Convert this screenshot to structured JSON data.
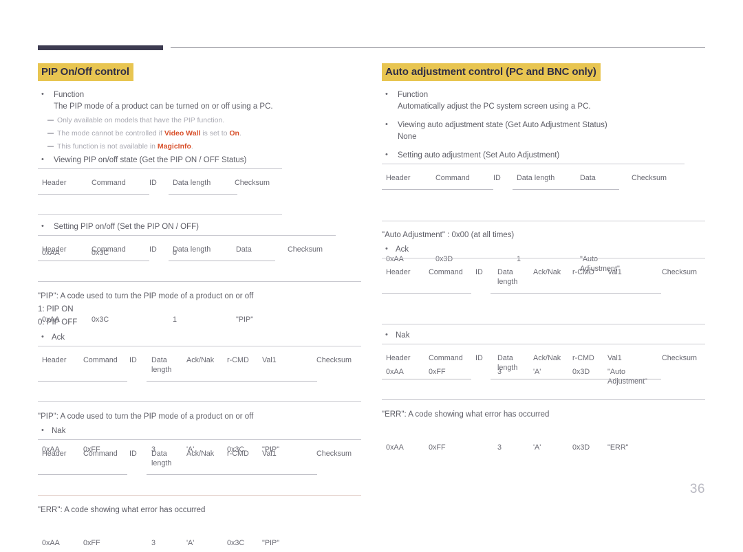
{
  "page": {
    "number": "36"
  },
  "left": {
    "title": "PIP On/Off control",
    "function_label": "Function",
    "function_desc": "The PIP mode of a product can be turned on or off using a PC.",
    "notes": [
      {
        "pre": "Only available on models that have the PIP function.",
        "bold1": "",
        "mid": "",
        "bold2": "",
        "post": ""
      },
      {
        "pre": "The mode cannot be controlled if ",
        "bold1": "Video Wall",
        "mid": " is set to ",
        "bold2": "On",
        "post": "."
      },
      {
        "pre": "This function is not available in ",
        "bold1": "MagicInfo",
        "mid": "",
        "bold2": "",
        "post": "."
      }
    ],
    "get_label": "Viewing PIP on/off state (Get the PIP ON / OFF Status)",
    "get_table": {
      "headers": [
        "Header",
        "Command",
        "ID",
        "Data length",
        "Checksum"
      ],
      "values": [
        "0xAA",
        "0x3C",
        "",
        "0",
        ""
      ]
    },
    "set_label": "Setting PIP on/off (Set the PIP ON / OFF)",
    "set_table": {
      "headers": [
        "Header",
        "Command",
        "ID",
        "Data length",
        "Data",
        "Checksum"
      ],
      "values": [
        "0xAA",
        "0x3C",
        "",
        "1",
        "\"PIP\"",
        ""
      ]
    },
    "pip_desc": "\"PIP\": A code used to turn the PIP mode of a product on or off",
    "pip_on": "1: PIP ON",
    "pip_off": "0: PIP OFF",
    "ack_label": "Ack",
    "ack_table": {
      "headers": [
        "Header",
        "Command",
        "ID",
        "Data\nlength",
        "Ack/Nak",
        "r-CMD",
        "Val1",
        "Checksum"
      ],
      "values": [
        "0xAA",
        "0xFF",
        "",
        "3",
        "'A'",
        "0x3C",
        "\"PIP\"",
        ""
      ]
    },
    "pip_desc2": "\"PIP\": A code used to turn the PIP mode of a product on or off",
    "nak_label": "Nak",
    "nak_table": {
      "headers": [
        "Header",
        "Command",
        "ID",
        "Data\nlength",
        "Ack/Nak",
        "r-CMD",
        "Val1",
        "Checksum"
      ],
      "values": [
        "0xAA",
        "0xFF",
        "",
        "3",
        "'A'",
        "0x3C",
        "\"PIP\"",
        ""
      ]
    },
    "err_desc": "\"ERR\": A code showing what error has occurred"
  },
  "right": {
    "title": "Auto adjustment control (PC and BNC only)",
    "function_label": "Function",
    "function_desc": "Automatically adjust the PC system screen using a PC.",
    "get_label": "Viewing auto adjustment state (Get Auto Adjustment Status)",
    "get_value": "None",
    "set_label": "Setting auto adjustment (Set Auto Adjustment)",
    "set_table": {
      "headers": [
        "Header",
        "Command",
        "ID",
        "Data length",
        "Data",
        "Checksum"
      ],
      "values": [
        "0xAA",
        "0x3D",
        "",
        "1",
        "\"Auto\nAdjustment\"",
        ""
      ]
    },
    "auto_desc": "\"Auto Adjustment\" : 0x00 (at all times)",
    "ack_label": "Ack",
    "ack_table": {
      "headers": [
        "Header",
        "Command",
        "ID",
        "Data\nlength",
        "Ack/Nak",
        "r-CMD",
        "Val1",
        "Checksum"
      ],
      "values": [
        "0xAA",
        "0xFF",
        "",
        "3",
        "'A'",
        "0x3D",
        "\"Auto\nAdjustment\"",
        ""
      ]
    },
    "nak_label": "Nak",
    "nak_table": {
      "headers": [
        "Header",
        "Command",
        "ID",
        "Data\nlength",
        "Ack/Nak",
        "r-CMD",
        "Val1",
        "Checksum"
      ],
      "values": [
        "0xAA",
        "0xFF",
        "",
        "3",
        "'A'",
        "0x3D",
        "\"ERR\"",
        ""
      ]
    },
    "err_desc": "\"ERR\": A code showing what error has occurred"
  },
  "colors": {
    "accent_highlight": "#e8c551",
    "title_text": "#2f2d45",
    "emphasis": "#d8512c",
    "body_text": "#5d5d66",
    "note_text": "#a9a9b2",
    "rule": "#c9c9d0",
    "top_bar": "#3d3b51"
  }
}
